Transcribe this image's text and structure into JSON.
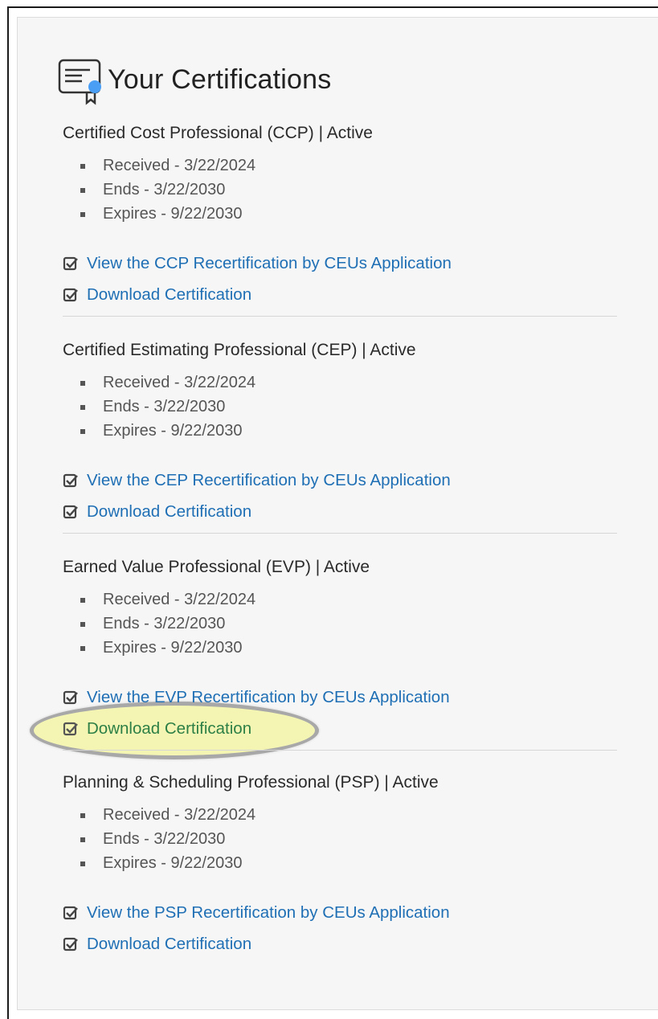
{
  "page": {
    "title": "Your Certifications",
    "icon": "certificate-icon",
    "colors": {
      "link": "#1f6fb5",
      "highlight_fill": "#f4f5b3",
      "highlight_ring": "#a8a8a8",
      "panel": "#f6f6f6"
    }
  },
  "certifications": [
    {
      "title": "Certified Cost Professional (CCP) | Active",
      "received": "Received - 3/22/2024",
      "ends": "Ends - 3/22/2030",
      "expires": "Expires - 9/22/2030",
      "recert_link": "View the CCP Recertification by CEUs Application",
      "download_link": "Download Certification"
    },
    {
      "title": "Certified Estimating Professional (CEP) | Active",
      "received": "Received - 3/22/2024",
      "ends": "Ends - 3/22/2030",
      "expires": "Expires - 9/22/2030",
      "recert_link": "View the CEP Recertification by CEUs Application",
      "download_link": "Download Certification"
    },
    {
      "title": "Earned Value Professional (EVP) | Active",
      "received": "Received - 3/22/2024",
      "ends": "Ends - 3/22/2030",
      "expires": "Expires - 9/22/2030",
      "recert_link": "View the EVP Recertification by CEUs Application",
      "download_link": "Download Certification"
    },
    {
      "title": "Planning & Scheduling Professional (PSP) | Active",
      "received": "Received - 3/22/2024",
      "ends": "Ends - 3/22/2030",
      "expires": "Expires - 9/22/2030",
      "recert_link": "View the PSP Recertification by CEUs Application",
      "download_link": "Download Certification"
    }
  ]
}
